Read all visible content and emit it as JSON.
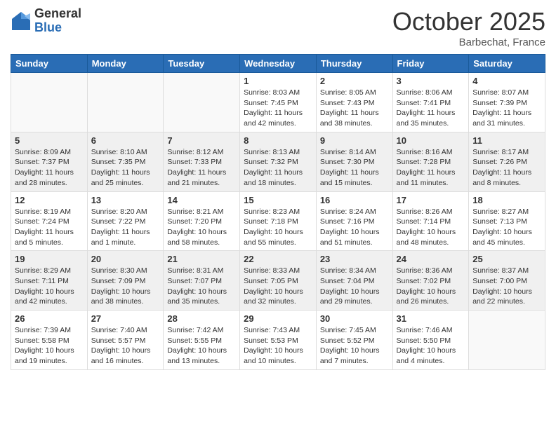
{
  "header": {
    "logo_general": "General",
    "logo_blue": "Blue",
    "month_title": "October 2025",
    "subtitle": "Barbechat, France"
  },
  "weekdays": [
    "Sunday",
    "Monday",
    "Tuesday",
    "Wednesday",
    "Thursday",
    "Friday",
    "Saturday"
  ],
  "weeks": [
    {
      "shaded": false,
      "days": [
        {
          "num": "",
          "sunrise": "",
          "sunset": "",
          "daylight": ""
        },
        {
          "num": "",
          "sunrise": "",
          "sunset": "",
          "daylight": ""
        },
        {
          "num": "",
          "sunrise": "",
          "sunset": "",
          "daylight": ""
        },
        {
          "num": "1",
          "sunrise": "Sunrise: 8:03 AM",
          "sunset": "Sunset: 7:45 PM",
          "daylight": "Daylight: 11 hours and 42 minutes."
        },
        {
          "num": "2",
          "sunrise": "Sunrise: 8:05 AM",
          "sunset": "Sunset: 7:43 PM",
          "daylight": "Daylight: 11 hours and 38 minutes."
        },
        {
          "num": "3",
          "sunrise": "Sunrise: 8:06 AM",
          "sunset": "Sunset: 7:41 PM",
          "daylight": "Daylight: 11 hours and 35 minutes."
        },
        {
          "num": "4",
          "sunrise": "Sunrise: 8:07 AM",
          "sunset": "Sunset: 7:39 PM",
          "daylight": "Daylight: 11 hours and 31 minutes."
        }
      ]
    },
    {
      "shaded": true,
      "days": [
        {
          "num": "5",
          "sunrise": "Sunrise: 8:09 AM",
          "sunset": "Sunset: 7:37 PM",
          "daylight": "Daylight: 11 hours and 28 minutes."
        },
        {
          "num": "6",
          "sunrise": "Sunrise: 8:10 AM",
          "sunset": "Sunset: 7:35 PM",
          "daylight": "Daylight: 11 hours and 25 minutes."
        },
        {
          "num": "7",
          "sunrise": "Sunrise: 8:12 AM",
          "sunset": "Sunset: 7:33 PM",
          "daylight": "Daylight: 11 hours and 21 minutes."
        },
        {
          "num": "8",
          "sunrise": "Sunrise: 8:13 AM",
          "sunset": "Sunset: 7:32 PM",
          "daylight": "Daylight: 11 hours and 18 minutes."
        },
        {
          "num": "9",
          "sunrise": "Sunrise: 8:14 AM",
          "sunset": "Sunset: 7:30 PM",
          "daylight": "Daylight: 11 hours and 15 minutes."
        },
        {
          "num": "10",
          "sunrise": "Sunrise: 8:16 AM",
          "sunset": "Sunset: 7:28 PM",
          "daylight": "Daylight: 11 hours and 11 minutes."
        },
        {
          "num": "11",
          "sunrise": "Sunrise: 8:17 AM",
          "sunset": "Sunset: 7:26 PM",
          "daylight": "Daylight: 11 hours and 8 minutes."
        }
      ]
    },
    {
      "shaded": false,
      "days": [
        {
          "num": "12",
          "sunrise": "Sunrise: 8:19 AM",
          "sunset": "Sunset: 7:24 PM",
          "daylight": "Daylight: 11 hours and 5 minutes."
        },
        {
          "num": "13",
          "sunrise": "Sunrise: 8:20 AM",
          "sunset": "Sunset: 7:22 PM",
          "daylight": "Daylight: 11 hours and 1 minute."
        },
        {
          "num": "14",
          "sunrise": "Sunrise: 8:21 AM",
          "sunset": "Sunset: 7:20 PM",
          "daylight": "Daylight: 10 hours and 58 minutes."
        },
        {
          "num": "15",
          "sunrise": "Sunrise: 8:23 AM",
          "sunset": "Sunset: 7:18 PM",
          "daylight": "Daylight: 10 hours and 55 minutes."
        },
        {
          "num": "16",
          "sunrise": "Sunrise: 8:24 AM",
          "sunset": "Sunset: 7:16 PM",
          "daylight": "Daylight: 10 hours and 51 minutes."
        },
        {
          "num": "17",
          "sunrise": "Sunrise: 8:26 AM",
          "sunset": "Sunset: 7:14 PM",
          "daylight": "Daylight: 10 hours and 48 minutes."
        },
        {
          "num": "18",
          "sunrise": "Sunrise: 8:27 AM",
          "sunset": "Sunset: 7:13 PM",
          "daylight": "Daylight: 10 hours and 45 minutes."
        }
      ]
    },
    {
      "shaded": true,
      "days": [
        {
          "num": "19",
          "sunrise": "Sunrise: 8:29 AM",
          "sunset": "Sunset: 7:11 PM",
          "daylight": "Daylight: 10 hours and 42 minutes."
        },
        {
          "num": "20",
          "sunrise": "Sunrise: 8:30 AM",
          "sunset": "Sunset: 7:09 PM",
          "daylight": "Daylight: 10 hours and 38 minutes."
        },
        {
          "num": "21",
          "sunrise": "Sunrise: 8:31 AM",
          "sunset": "Sunset: 7:07 PM",
          "daylight": "Daylight: 10 hours and 35 minutes."
        },
        {
          "num": "22",
          "sunrise": "Sunrise: 8:33 AM",
          "sunset": "Sunset: 7:05 PM",
          "daylight": "Daylight: 10 hours and 32 minutes."
        },
        {
          "num": "23",
          "sunrise": "Sunrise: 8:34 AM",
          "sunset": "Sunset: 7:04 PM",
          "daylight": "Daylight: 10 hours and 29 minutes."
        },
        {
          "num": "24",
          "sunrise": "Sunrise: 8:36 AM",
          "sunset": "Sunset: 7:02 PM",
          "daylight": "Daylight: 10 hours and 26 minutes."
        },
        {
          "num": "25",
          "sunrise": "Sunrise: 8:37 AM",
          "sunset": "Sunset: 7:00 PM",
          "daylight": "Daylight: 10 hours and 22 minutes."
        }
      ]
    },
    {
      "shaded": false,
      "days": [
        {
          "num": "26",
          "sunrise": "Sunrise: 7:39 AM",
          "sunset": "Sunset: 5:58 PM",
          "daylight": "Daylight: 10 hours and 19 minutes."
        },
        {
          "num": "27",
          "sunrise": "Sunrise: 7:40 AM",
          "sunset": "Sunset: 5:57 PM",
          "daylight": "Daylight: 10 hours and 16 minutes."
        },
        {
          "num": "28",
          "sunrise": "Sunrise: 7:42 AM",
          "sunset": "Sunset: 5:55 PM",
          "daylight": "Daylight: 10 hours and 13 minutes."
        },
        {
          "num": "29",
          "sunrise": "Sunrise: 7:43 AM",
          "sunset": "Sunset: 5:53 PM",
          "daylight": "Daylight: 10 hours and 10 minutes."
        },
        {
          "num": "30",
          "sunrise": "Sunrise: 7:45 AM",
          "sunset": "Sunset: 5:52 PM",
          "daylight": "Daylight: 10 hours and 7 minutes."
        },
        {
          "num": "31",
          "sunrise": "Sunrise: 7:46 AM",
          "sunset": "Sunset: 5:50 PM",
          "daylight": "Daylight: 10 hours and 4 minutes."
        },
        {
          "num": "",
          "sunrise": "",
          "sunset": "",
          "daylight": ""
        }
      ]
    }
  ]
}
